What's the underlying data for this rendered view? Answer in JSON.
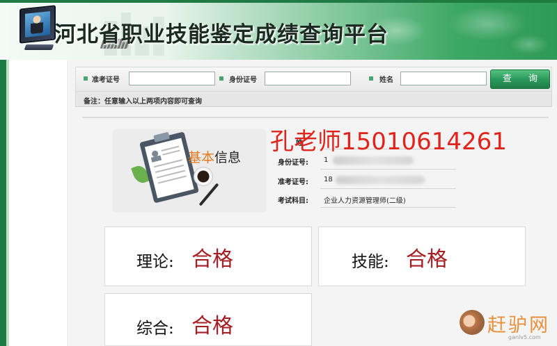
{
  "header": {
    "site_title": "河北省职业技能鉴定成绩查询平台"
  },
  "search": {
    "exam_id_label": "准考证号",
    "exam_id_value": "",
    "id_card_label": "身份证号",
    "id_card_value": "",
    "name_label": "姓名",
    "name_value": "",
    "query_button": "查 询",
    "note": "备注：任意输入以上两项内容即可查询"
  },
  "basic_info": {
    "heading_part1": "基本",
    "heading_part2": "信息",
    "name_label": "姓",
    "id_label": "身份证号:",
    "id_value_visible": "1",
    "exam_label": "准考证号:",
    "exam_value_visible": "18",
    "subject_label": "考试科目:",
    "subject_value": "企业人力资源管理师(二级)"
  },
  "watermark": {
    "text": "孔老师15010614261"
  },
  "results": [
    {
      "label": "理论:",
      "value": "合格"
    },
    {
      "label": "技能:",
      "value": "合格"
    },
    {
      "label": "综合:",
      "value": "合格"
    }
  ],
  "logo": {
    "text": "赶驴网",
    "sub": "ganlv5.com"
  },
  "colors": {
    "brand_green": "#1e7a44",
    "pass_red": "#a61d24",
    "watermark_red": "#e0231b",
    "heading_orange": "#e07a1f"
  }
}
